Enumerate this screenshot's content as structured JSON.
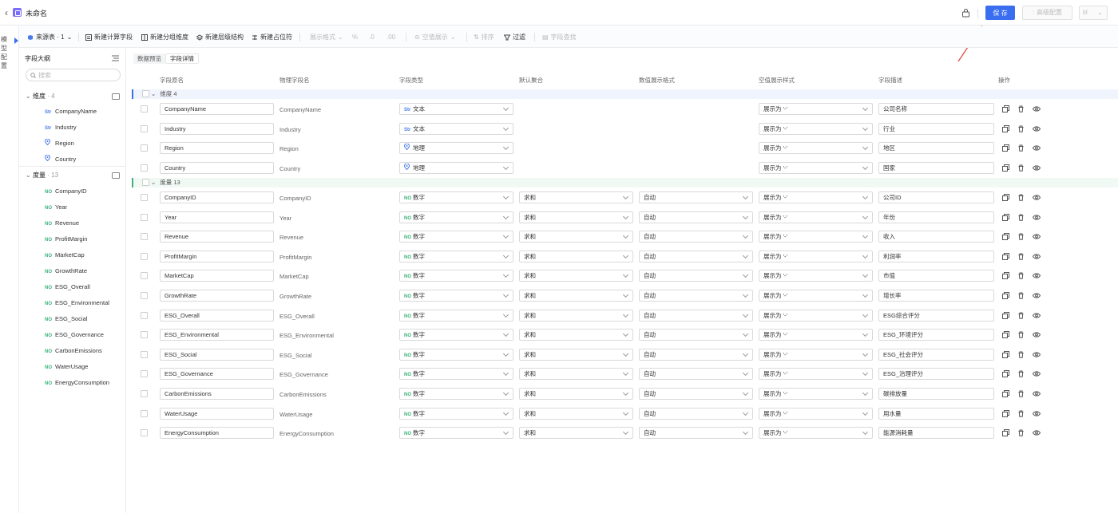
{
  "header": {
    "title": "未命名",
    "save_label": "保 存",
    "advanced_config_label": "高级配置",
    "chart_type_label": "lıl"
  },
  "rail": {
    "label": "模型配置"
  },
  "toolbar": {
    "source_table": "来源表 · 1",
    "new_calc_field": "新建计算字段",
    "new_group_dim": "新建分组维度",
    "new_hierarchy": "新建层级结构",
    "new_placeholder": "新建占位符",
    "display_format": "展示格式",
    "percent": "%",
    "decimals": ".0",
    "thousands": ".00",
    "null_display": "空值展示",
    "sort": "排序",
    "filter": "过滤",
    "field_search": "字段查找"
  },
  "sidebar": {
    "title": "字段大纲",
    "search_placeholder": "搜索",
    "dimension_group": {
      "label": "维度",
      "count": "· 4"
    },
    "measure_group": {
      "label": "度量",
      "count": "· 13"
    },
    "dimension_items": [
      {
        "tag": "Str",
        "name": "CompanyName"
      },
      {
        "tag": "Str",
        "name": "Industry"
      },
      {
        "tag": "geo",
        "name": "Region"
      },
      {
        "tag": "geo",
        "name": "Country"
      }
    ],
    "measure_items": [
      {
        "tag": "NO",
        "name": "CompanyID"
      },
      {
        "tag": "NO",
        "name": "Year"
      },
      {
        "tag": "NO",
        "name": "Revenue"
      },
      {
        "tag": "NO",
        "name": "ProfitMargin"
      },
      {
        "tag": "NO",
        "name": "MarketCap"
      },
      {
        "tag": "NO",
        "name": "GrowthRate"
      },
      {
        "tag": "NO",
        "name": "ESG_Overall"
      },
      {
        "tag": "NO",
        "name": "ESG_Environmental"
      },
      {
        "tag": "NO",
        "name": "ESG_Social"
      },
      {
        "tag": "NO",
        "name": "ESG_Governance"
      },
      {
        "tag": "NO",
        "name": "CarbonEmissions"
      },
      {
        "tag": "NO",
        "name": "WaterUsage"
      },
      {
        "tag": "NO",
        "name": "EnergyConsumption"
      }
    ]
  },
  "tabs": [
    {
      "label": "数据预览"
    },
    {
      "label": "字段详情"
    }
  ],
  "table": {
    "columns": [
      "字段原名",
      "物理字段名",
      "字段类型",
      "默认聚合",
      "数值展示格式",
      "空值展示样式",
      "字段描述",
      "操作"
    ],
    "dim_group_label": "维度 4",
    "mea_group_label": "度量 13",
    "dim_rows": [
      {
        "name": "CompanyName",
        "physical": "CompanyName",
        "type_tag": "Str",
        "type": "文本",
        "null_display": "展示为 '-'",
        "desc": "公司名称"
      },
      {
        "name": "Industry",
        "physical": "Industry",
        "type_tag": "Str",
        "type": "文本",
        "null_display": "展示为 '-'",
        "desc": "行业"
      },
      {
        "name": "Region",
        "physical": "Region",
        "type_tag": "geo",
        "type": "地理",
        "null_display": "展示为 '-'",
        "desc": "地区"
      },
      {
        "name": "Country",
        "physical": "Country",
        "type_tag": "geo",
        "type": "地理",
        "null_display": "展示为 '-'",
        "desc": "国家"
      }
    ],
    "mea_rows": [
      {
        "name": "CompanyID",
        "physical": "CompanyID",
        "type_tag": "NO",
        "type": "数字",
        "agg": "求和",
        "fmt": "自动",
        "null_display": "展示为 '-'",
        "desc": "公司ID"
      },
      {
        "name": "Year",
        "physical": "Year",
        "type_tag": "NO",
        "type": "数字",
        "agg": "求和",
        "fmt": "自动",
        "null_display": "展示为 '-'",
        "desc": "年份"
      },
      {
        "name": "Revenue",
        "physical": "Revenue",
        "type_tag": "NO",
        "type": "数字",
        "agg": "求和",
        "fmt": "自动",
        "null_display": "展示为 '-'",
        "desc": "收入"
      },
      {
        "name": "ProfitMargin",
        "physical": "ProfitMargin",
        "type_tag": "NO",
        "type": "数字",
        "agg": "求和",
        "fmt": "自动",
        "null_display": "展示为 '-'",
        "desc": "利润率"
      },
      {
        "name": "MarketCap",
        "physical": "MarketCap",
        "type_tag": "NO",
        "type": "数字",
        "agg": "求和",
        "fmt": "自动",
        "null_display": "展示为 '-'",
        "desc": "市值"
      },
      {
        "name": "GrowthRate",
        "physical": "GrowthRate",
        "type_tag": "NO",
        "type": "数字",
        "agg": "求和",
        "fmt": "自动",
        "null_display": "展示为 '-'",
        "desc": "增长率"
      },
      {
        "name": "ESG_Overall",
        "physical": "ESG_Overall",
        "type_tag": "NO",
        "type": "数字",
        "agg": "求和",
        "fmt": "自动",
        "null_display": "展示为 '-'",
        "desc": "ESG综合评分"
      },
      {
        "name": "ESG_Environmental",
        "physical": "ESG_Environmental",
        "type_tag": "NO",
        "type": "数字",
        "agg": "求和",
        "fmt": "自动",
        "null_display": "展示为 '-'",
        "desc": "ESG_环境评分"
      },
      {
        "name": "ESG_Social",
        "physical": "ESG_Social",
        "type_tag": "NO",
        "type": "数字",
        "agg": "求和",
        "fmt": "自动",
        "null_display": "展示为 '-'",
        "desc": "ESG_社会评分"
      },
      {
        "name": "ESG_Governance",
        "physical": "ESG_Governance",
        "type_tag": "NO",
        "type": "数字",
        "agg": "求和",
        "fmt": "自动",
        "null_display": "展示为 '-'",
        "desc": "ESG_治理评分"
      },
      {
        "name": "CarbonEmissions",
        "physical": "CarbonEmissions",
        "type_tag": "NO",
        "type": "数字",
        "agg": "求和",
        "fmt": "自动",
        "null_display": "展示为 '-'",
        "desc": "碳排放量"
      },
      {
        "name": "WaterUsage",
        "physical": "WaterUsage",
        "type_tag": "NO",
        "type": "数字",
        "agg": "求和",
        "fmt": "自动",
        "null_display": "展示为 '-'",
        "desc": "用水量"
      },
      {
        "name": "EnergyConsumption",
        "physical": "EnergyConsumption",
        "type_tag": "NO",
        "type": "数字",
        "agg": "求和",
        "fmt": "自动",
        "null_display": "展示为 '-'",
        "desc": "能源消耗量"
      }
    ]
  },
  "colors": {
    "primary": "#3a6df0",
    "dimension": "#4a7be8",
    "measure": "#3bb37a",
    "annotation_arrow": "#e0453a"
  }
}
